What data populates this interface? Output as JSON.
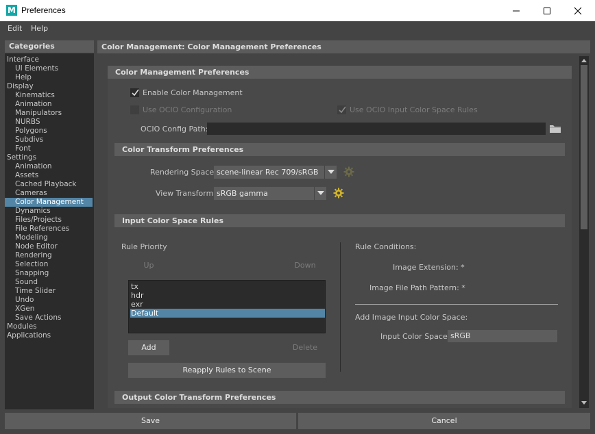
{
  "window": {
    "app_logo": "M",
    "title": "Preferences"
  },
  "menubar": {
    "items": [
      "Edit",
      "Help"
    ]
  },
  "categories": {
    "header": "Categories",
    "items": [
      {
        "label": "Interface",
        "level": 0
      },
      {
        "label": "UI Elements",
        "level": 1
      },
      {
        "label": "Help",
        "level": 1
      },
      {
        "label": "Display",
        "level": 0
      },
      {
        "label": "Kinematics",
        "level": 1
      },
      {
        "label": "Animation",
        "level": 1
      },
      {
        "label": "Manipulators",
        "level": 1
      },
      {
        "label": "NURBS",
        "level": 1
      },
      {
        "label": "Polygons",
        "level": 1
      },
      {
        "label": "Subdivs",
        "level": 1
      },
      {
        "label": "Font",
        "level": 1
      },
      {
        "label": "Settings",
        "level": 0
      },
      {
        "label": "Animation",
        "level": 1
      },
      {
        "label": "Assets",
        "level": 1
      },
      {
        "label": "Cached Playback",
        "level": 1
      },
      {
        "label": "Cameras",
        "level": 1
      },
      {
        "label": "Color Management",
        "level": 1,
        "selected": true
      },
      {
        "label": "Dynamics",
        "level": 1
      },
      {
        "label": "Files/Projects",
        "level": 1
      },
      {
        "label": "File References",
        "level": 1
      },
      {
        "label": "Modeling",
        "level": 1
      },
      {
        "label": "Node Editor",
        "level": 1
      },
      {
        "label": "Rendering",
        "level": 1
      },
      {
        "label": "Selection",
        "level": 1
      },
      {
        "label": "Snapping",
        "level": 1
      },
      {
        "label": "Sound",
        "level": 1
      },
      {
        "label": "Time Slider",
        "level": 1
      },
      {
        "label": "Undo",
        "level": 1
      },
      {
        "label": "XGen",
        "level": 1
      },
      {
        "label": "Save Actions",
        "level": 1
      },
      {
        "label": "Modules",
        "level": 0
      },
      {
        "label": "Applications",
        "level": 0
      }
    ]
  },
  "main": {
    "header": "Color Management: Color Management Preferences",
    "cm_prefs": {
      "section_title": "Color Management Preferences",
      "enable_label": "Enable Color Management",
      "enable_checked": true,
      "use_ocio_label": "Use OCIO Configuration",
      "use_ocio_checked": false,
      "use_ocio_rules_label": "Use OCIO Input Color Space Rules",
      "use_ocio_rules_checked": true,
      "ocio_path_label": "OCIO Config Path:",
      "ocio_path_value": ""
    },
    "transform_prefs": {
      "section_title": "Color Transform Preferences",
      "rendering_space_label": "Rendering Space:",
      "rendering_space_value": "scene-linear Rec 709/sRGB",
      "view_transform_label": "View Transform:",
      "view_transform_value": "sRGB gamma"
    },
    "input_rules": {
      "section_title": "Input Color Space Rules",
      "rule_priority_label": "Rule Priority",
      "up_label": "Up",
      "down_label": "Down",
      "rules": [
        "tx",
        "hdr",
        "exr",
        "Default"
      ],
      "selected_rule": "Default",
      "add_label": "Add",
      "delete_label": "Delete",
      "reapply_label": "Reapply Rules to Scene",
      "rule_conditions_label": "Rule Conditions:",
      "image_extension_label": "Image Extension: *",
      "image_path_label": "Image File Path Pattern: *",
      "add_input_label": "Add Image Input Color Space:",
      "input_color_space_label": "Input Color Space:",
      "input_color_space_value": "sRGB"
    },
    "output_prefs": {
      "section_title": "Output Color Transform Preferences"
    }
  },
  "footer": {
    "save_label": "Save",
    "cancel_label": "Cancel"
  },
  "colors": {
    "selection": "#5285a6",
    "app_logo": "#13a7a8",
    "gear_active": "#d4b62a",
    "gear_disabled": "#6d6a48"
  }
}
